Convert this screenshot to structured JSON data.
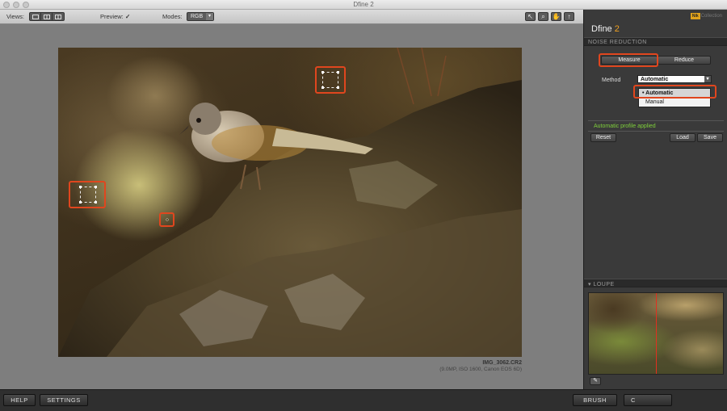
{
  "window": {
    "title": "Dfine 2"
  },
  "toolbar": {
    "views_label": "Views:",
    "preview_label": "Preview:",
    "preview_check": "✓",
    "modes_label": "Modes:",
    "mode_value": "RGB",
    "tools": [
      "↖",
      "⌕",
      "✋",
      "↑"
    ]
  },
  "image": {
    "filename": "IMG_3062.CR2",
    "meta": "(9.0MP, ISO 1600, Canon EOS 6D)"
  },
  "panel": {
    "logo_badge": "Nik",
    "logo_text": "Collection",
    "product": "Dfine",
    "version": "2",
    "section_noise": "NOISE REDUCTION",
    "measure_label": "Measure",
    "reduce_label": "Reduce",
    "method_label": "Method",
    "method_value": "Automatic",
    "method_options": [
      "Automatic",
      "Manual"
    ],
    "status": "Automatic profile applied",
    "reset_label": "Reset",
    "load_label": "Load",
    "save_label": "Save",
    "section_loupe": "LOUPE"
  },
  "bottom": {
    "help_label": "HELP",
    "settings_label": "SETTINGS",
    "brush_label": "BRUSH",
    "cancel_label": "C"
  },
  "colors": {
    "accent": "#f0a020",
    "highlight": "#e0461e",
    "status": "#7ecf3a"
  }
}
